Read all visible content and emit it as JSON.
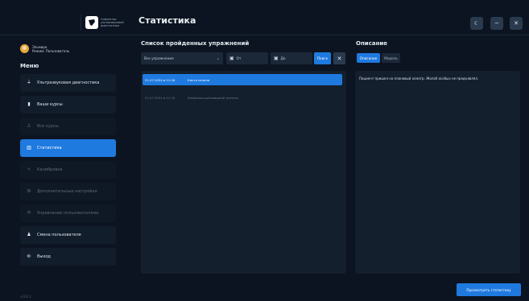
{
  "app": {
    "logo_text": "Симулятор ультразвуковой диагностики",
    "version": "v.0.0.1"
  },
  "user": {
    "name": "Эльмира",
    "role": "Режим: Пользователь"
  },
  "sidebar": {
    "title": "Меню",
    "items": [
      {
        "label": "Ультразвуковая диагностика",
        "state": "normal",
        "icon": "⏚"
      },
      {
        "label": "Ваши курсы",
        "state": "normal",
        "icon": "▮"
      },
      {
        "label": "Все курсы",
        "state": "dim",
        "icon": "♙"
      },
      {
        "label": "Статистика",
        "state": "active",
        "icon": "▥"
      },
      {
        "label": "Калибровка",
        "state": "dim",
        "icon": "✧"
      },
      {
        "label": "Дополнительные настройки",
        "state": "dim",
        "icon": "⚙"
      },
      {
        "label": "Управление пользователями",
        "state": "dim",
        "icon": "⁜"
      },
      {
        "label": "Смена пользователя",
        "state": "normal",
        "icon": "♟"
      },
      {
        "label": "Выход",
        "state": "normal",
        "icon": "⎆"
      }
    ]
  },
  "header": {
    "title": "Статистика",
    "theme_icon": "☾",
    "minimize_icon": "−",
    "close_icon": "✕"
  },
  "exercises": {
    "title": "Список пройденных упражнений",
    "filter_value": "Все упражнения",
    "date_from_placeholder": "От",
    "date_to_placeholder": "До",
    "search_label": "Поиск",
    "clear_icon": "✕",
    "rows": [
      {
        "date": "21.07.2024 в 11:18",
        "name": "Киста печени",
        "selected": true
      },
      {
        "date": "21.07.2024 в 11:19",
        "name": "Аномалия щитовидной железы",
        "selected": false
      }
    ]
  },
  "description": {
    "title": "Описание",
    "tabs": [
      {
        "label": "Описание",
        "active": true
      },
      {
        "label": "Модель",
        "active": false
      }
    ],
    "text": "Пациент пришел на плановый осмотр. Жалоб особых не предъявлял."
  },
  "footer": {
    "view_stats_label": "Просмотреть статистику"
  },
  "colors": {
    "accent": "#1f7ae0",
    "background": "#0b1420",
    "panel": "#141f2d"
  }
}
